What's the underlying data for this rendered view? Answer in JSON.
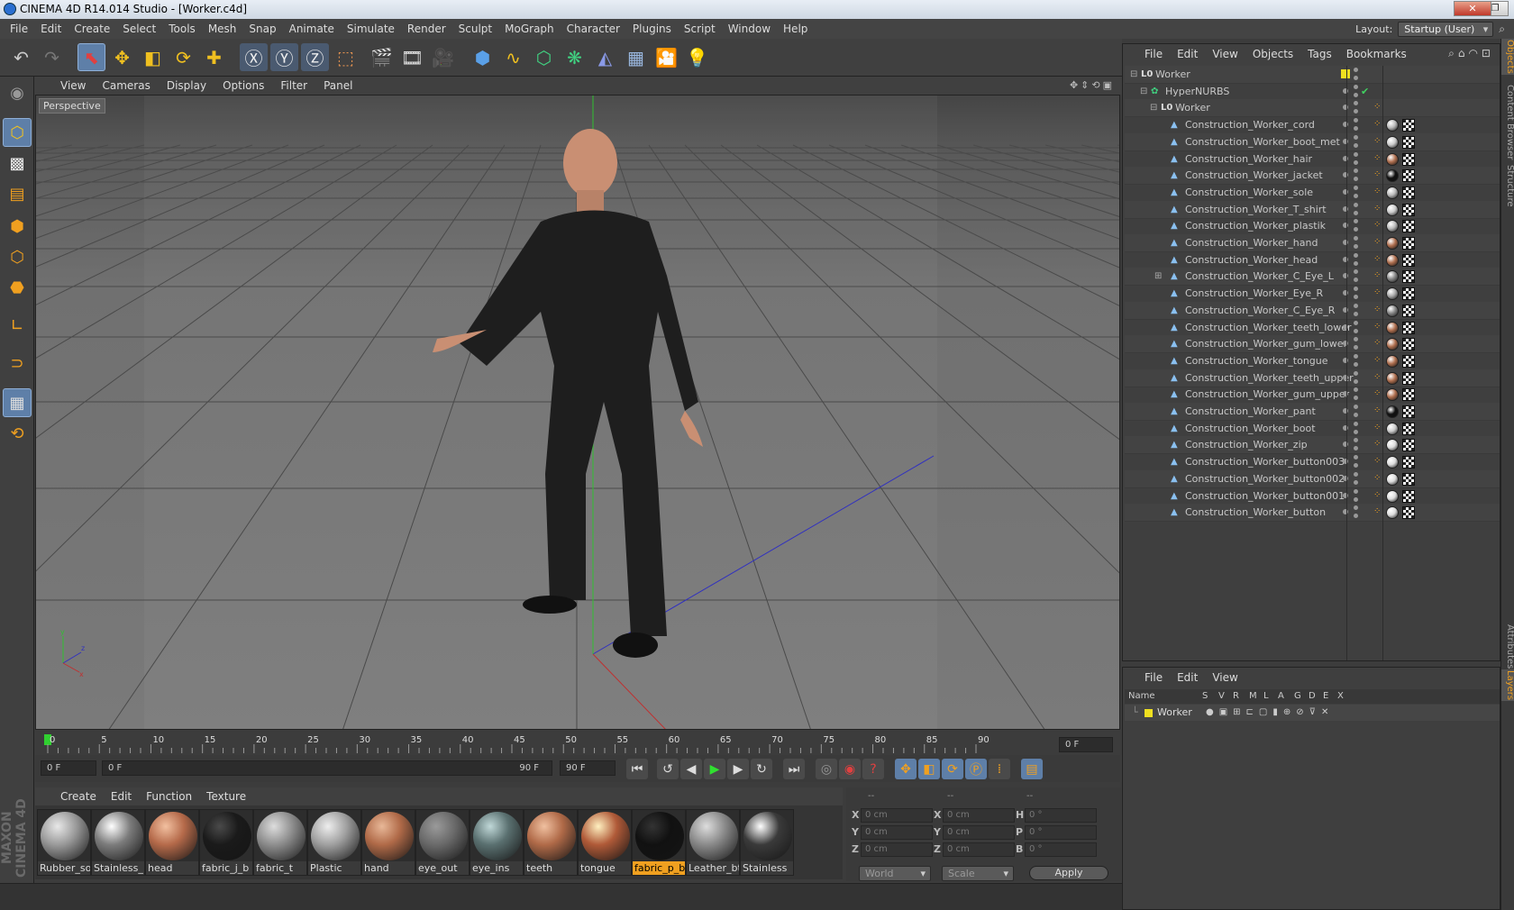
{
  "window": {
    "title": "CINEMA 4D R14.014 Studio - [Worker.c4d]"
  },
  "menu": [
    "File",
    "Edit",
    "Create",
    "Select",
    "Tools",
    "Mesh",
    "Snap",
    "Animate",
    "Simulate",
    "Render",
    "Sculpt",
    "MoGraph",
    "Character",
    "Plugins",
    "Script",
    "Window",
    "Help"
  ],
  "layout": {
    "label": "Layout:",
    "value": "Startup (User)"
  },
  "viewport": {
    "menu": [
      "View",
      "Cameras",
      "Display",
      "Options",
      "Filter",
      "Panel"
    ],
    "label": "Perspective"
  },
  "timeline": {
    "ticks": [
      "0",
      "5",
      "10",
      "15",
      "20",
      "25",
      "30",
      "35",
      "40",
      "45",
      "50",
      "55",
      "60",
      "65",
      "70",
      "75",
      "80",
      "85",
      "90"
    ],
    "current": "0 F"
  },
  "transport": {
    "start": "0 F",
    "slider_start": "0 F",
    "slider_end": "90 F",
    "end": "90 F"
  },
  "materials": {
    "menu": [
      "Create",
      "Edit",
      "Function",
      "Texture"
    ],
    "items": [
      {
        "name": "Rubber_so",
        "color": "#9a9a9a",
        "spec": "#e8e8e8"
      },
      {
        "name": "Stainless_",
        "color": "#7c7c7c",
        "spec": "#ffffff"
      },
      {
        "name": "head",
        "color": "#b56a4a",
        "spec": "#f2c0a0"
      },
      {
        "name": "fabric_j_b",
        "color": "#1a1a1a",
        "spec": "#4a4a4a"
      },
      {
        "name": "fabric_t",
        "color": "#8e8e8e",
        "spec": "#dddddd"
      },
      {
        "name": "Plastic",
        "color": "#a0a0a0",
        "spec": "#eeeeee"
      },
      {
        "name": "hand",
        "color": "#b06a48",
        "spec": "#e8b898"
      },
      {
        "name": "eye_out",
        "color": "#6a6a6a",
        "spec": "#9a9a9a"
      },
      {
        "name": "eye_ins",
        "color": "#5a7070",
        "spec": "#c0d8d8"
      },
      {
        "name": "teeth",
        "color": "#b06a48",
        "spec": "#f0c0a0"
      },
      {
        "name": "tongue",
        "color": "#b05a38",
        "spec": "#fff0c0"
      },
      {
        "name": "fabric_p_b",
        "color": "#111111",
        "spec": "#333333"
      },
      {
        "name": "Leather_bt",
        "color": "#8a8a8a",
        "spec": "#dddddd"
      },
      {
        "name": "Stainless",
        "color": "#3a3a3a",
        "spec": "#ffffff"
      }
    ],
    "selected": "fabric_p_b"
  },
  "coords": {
    "headers": [
      "--",
      "--",
      "--"
    ],
    "rows": [
      {
        "a": "X",
        "av": "0 cm",
        "b": "X",
        "bv": "0 cm",
        "c": "H",
        "cv": "0 °"
      },
      {
        "a": "Y",
        "av": "0 cm",
        "b": "Y",
        "bv": "0 cm",
        "c": "P",
        "cv": "0 °"
      },
      {
        "a": "Z",
        "av": "0 cm",
        "b": "Z",
        "bv": "0 cm",
        "c": "B",
        "cv": "0 °"
      }
    ],
    "mode1": "World",
    "mode2": "Scale",
    "apply": "Apply"
  },
  "objects": {
    "menu": [
      "File",
      "Edit",
      "View",
      "Objects",
      "Tags",
      "Bookmarks"
    ],
    "tree": [
      {
        "name": "Worker",
        "level": 0,
        "type": "null"
      },
      {
        "name": "HyperNURBS",
        "level": 1,
        "type": "nurbs"
      },
      {
        "name": "Worker",
        "level": 2,
        "type": "null"
      },
      {
        "name": "Construction_Worker_cord",
        "level": 3,
        "mat": "#bbbbbb"
      },
      {
        "name": "Construction_Worker_boot_met",
        "level": 3,
        "mat": "#cccccc"
      },
      {
        "name": "Construction_Worker_hair",
        "level": 3,
        "mat": "#b07050"
      },
      {
        "name": "Construction_Worker_jacket",
        "level": 3,
        "mat": "#111111"
      },
      {
        "name": "Construction_Worker_sole",
        "level": 3,
        "mat": "#bbbbbb"
      },
      {
        "name": "Construction_Worker_T_shirt",
        "level": 3,
        "mat": "#cccccc"
      },
      {
        "name": "Construction_Worker_plastik",
        "level": 3,
        "mat": "#bbbbbb"
      },
      {
        "name": "Construction_Worker_hand",
        "level": 3,
        "mat": "#b07050"
      },
      {
        "name": "Construction_Worker_head",
        "level": 3,
        "mat": "#b07050"
      },
      {
        "name": "Construction_Worker_C_Eye_L",
        "level": 3,
        "mat": "#888888"
      },
      {
        "name": "Construction_Worker_Eye_R",
        "level": 3,
        "mat": "#aaaaaa"
      },
      {
        "name": "Construction_Worker_C_Eye_R",
        "level": 3,
        "mat": "#888888"
      },
      {
        "name": "Construction_Worker_teeth_lower",
        "level": 3,
        "mat": "#b07050"
      },
      {
        "name": "Construction_Worker_gum_lower",
        "level": 3,
        "mat": "#b07050"
      },
      {
        "name": "Construction_Worker_tongue",
        "level": 3,
        "mat": "#b07050"
      },
      {
        "name": "Construction_Worker_teeth_upper",
        "level": 3,
        "mat": "#b07050"
      },
      {
        "name": "Construction_Worker_gum_upper",
        "level": 3,
        "mat": "#b07050"
      },
      {
        "name": "Construction_Worker_pant",
        "level": 3,
        "mat": "#111111"
      },
      {
        "name": "Construction_Worker_boot",
        "level": 3,
        "mat": "#cccccc"
      },
      {
        "name": "Construction_Worker_zip",
        "level": 3,
        "mat": "#dddddd"
      },
      {
        "name": "Construction_Worker_button003",
        "level": 3,
        "mat": "#dddddd"
      },
      {
        "name": "Construction_Worker_button002",
        "level": 3,
        "mat": "#dddddd"
      },
      {
        "name": "Construction_Worker_button001",
        "level": 3,
        "mat": "#dddddd"
      },
      {
        "name": "Construction_Worker_button",
        "level": 3,
        "mat": "#dddddd"
      }
    ]
  },
  "layers": {
    "menu": [
      "File",
      "Edit",
      "View"
    ],
    "columns": [
      "Name",
      "S",
      "V",
      "R",
      "M",
      "L",
      "A",
      "G",
      "D",
      "E",
      "X"
    ],
    "row": "Worker"
  },
  "sidetabs": [
    "Objects",
    "Content Browser",
    "Structure",
    "Attributes",
    "Layers"
  ]
}
